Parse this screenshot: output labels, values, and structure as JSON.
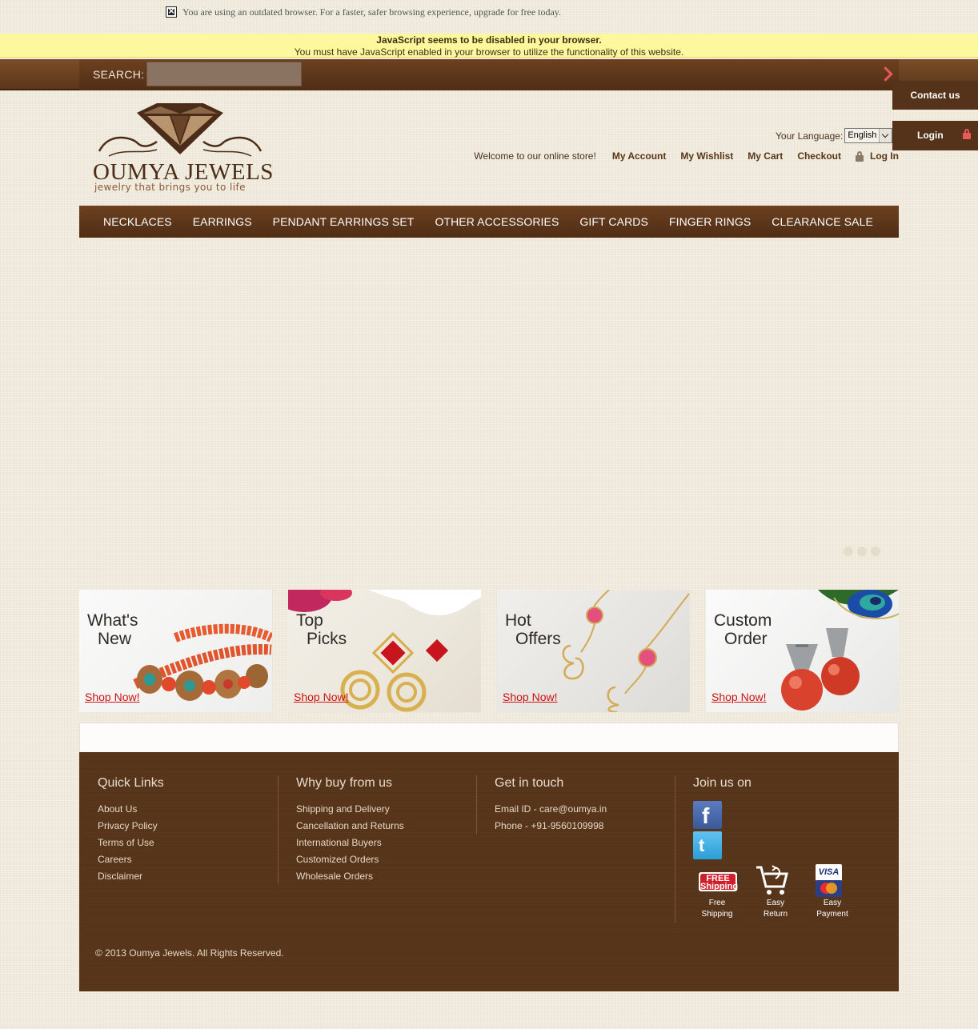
{
  "outdated_notice": "You are using an outdated browser. For a faster, safer browsing experience, upgrade for free today.",
  "js_warning": {
    "title": "JavaScript seems to be disabled in your browser.",
    "message": "You must have JavaScript enabled in your browser to utilize the functionality of this website."
  },
  "search": {
    "label": "SEARCH:",
    "value": ""
  },
  "side_tabs": {
    "contact": "Contact us",
    "login": "Login"
  },
  "logo": {
    "brand": "OUMYA JEWELS",
    "tagline": "jewelry that brings you to life"
  },
  "language": {
    "label": "Your Language:",
    "selected": "English"
  },
  "account": {
    "welcome": "Welcome to our online store!",
    "my_account": "My Account",
    "my_wishlist": "My Wishlist",
    "my_cart": "My Cart",
    "checkout": "Checkout",
    "log_in": "Log In"
  },
  "nav": [
    "NECKLACES",
    "EARRINGS",
    "PENDANT EARRINGS SET",
    "OTHER ACCESSORIES",
    "GIFT CARDS",
    "FINGER RINGS",
    "CLEARANCE SALE"
  ],
  "promos": [
    {
      "line1": "What's",
      "line2": "New",
      "cta": "Shop Now!"
    },
    {
      "line1": "Top",
      "line2": "Picks",
      "cta": "Shop Now!"
    },
    {
      "line1": "Hot",
      "line2": "Offers",
      "cta": "Shop Now!"
    },
    {
      "line1": "Custom",
      "line2": "Order",
      "cta": "Shop Now!"
    }
  ],
  "footer": {
    "quick_links": {
      "title": "Quick Links",
      "items": [
        "About Us",
        "Privacy Policy",
        "Terms of Use",
        "Careers",
        "Disclaimer"
      ]
    },
    "why_buy": {
      "title": "Why buy from us",
      "items": [
        "Shipping and Delivery",
        "Cancellation and Returns",
        "International Buyers",
        "Customized Orders",
        "Wholesale Orders"
      ]
    },
    "get_in_touch": {
      "title": "Get in touch",
      "items": [
        "Email ID - care@oumya.in",
        "Phone - +91-9560109998"
      ]
    },
    "join_us": {
      "title": "Join us on"
    },
    "badges": {
      "free_shipping": {
        "art": "FREE Shipping",
        "line1": "Free",
        "line2": "Shipping"
      },
      "easy_return": {
        "line1": "Easy",
        "line2": "Return"
      },
      "easy_payment": {
        "art": "VISA",
        "line1": "Easy",
        "line2": "Payment"
      }
    },
    "copyright": "© 2013 Oumya Jewels. All Rights Reserved."
  },
  "colors": {
    "brown": "#56341a",
    "accent_red": "#e85a5a",
    "warning_yellow": "#fdf89e",
    "background": "#efeadb"
  }
}
